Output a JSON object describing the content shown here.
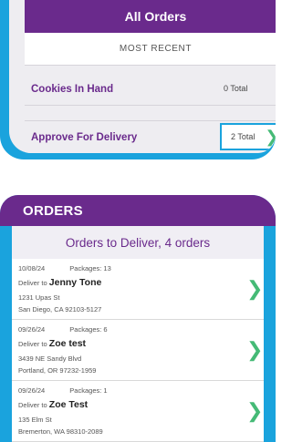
{
  "summary": {
    "title": "All Orders",
    "subtitle": "MOST RECENT",
    "rows": [
      {
        "label": "Cookies In Hand",
        "total": "0 Total"
      },
      {
        "label": "Approve For Delivery",
        "total": "2 Total"
      }
    ]
  },
  "orders": {
    "header": "ORDERS",
    "subheader": "Orders to Deliver, 4 orders",
    "deliver_prefix": "Deliver to",
    "items": [
      {
        "date": "10/08/24",
        "packages": "Packages: 13",
        "name": "Jenny Tone",
        "street": "1231 Upas St",
        "city": "San Diego, CA 92103-5127"
      },
      {
        "date": "09/26/24",
        "packages": "Packages: 6",
        "name": "Zoe test",
        "street": "3439 NE Sandy Blvd",
        "city": "Portland, OR 97232-1959"
      },
      {
        "date": "09/26/24",
        "packages": "Packages: 1",
        "name": "Zoe Test",
        "street": "135 Elm St",
        "city": "Bremerton, WA 98310-2089"
      }
    ]
  },
  "icons": {
    "chevron": "chevron-right-icon"
  },
  "colors": {
    "brand_purple": "#6a2a8c",
    "accent_blue": "#1aa3dd",
    "chevron_green": "#45ba76"
  }
}
